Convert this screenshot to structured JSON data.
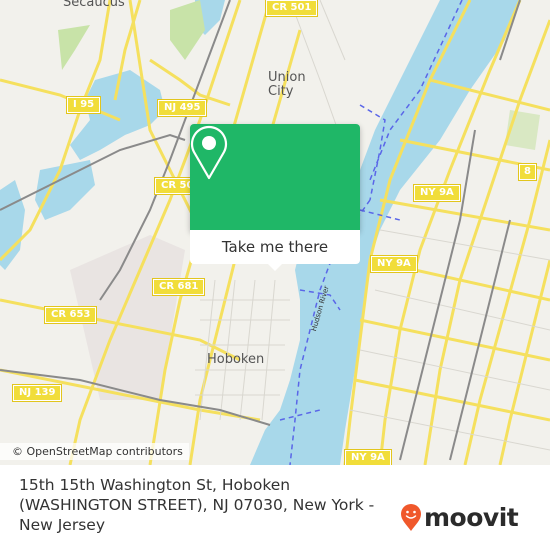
{
  "map": {
    "place_labels": [
      {
        "id": "secaucus",
        "text": "Secaucus"
      },
      {
        "id": "union-city",
        "text": "Union\nCity"
      },
      {
        "id": "hoboken",
        "text": "Hoboken"
      }
    ],
    "road_shields": [
      {
        "id": "cr-501",
        "text": "CR 501"
      },
      {
        "id": "i-95",
        "text": "I 95"
      },
      {
        "id": "nj-495",
        "text": "NJ 495"
      },
      {
        "id": "cr-50x",
        "text": "CR 50"
      },
      {
        "id": "ny-9a-north",
        "text": "NY 9A"
      },
      {
        "id": "ny-9a-mid",
        "text": "NY 9A"
      },
      {
        "id": "ny-9a-south",
        "text": "NY 9A"
      },
      {
        "id": "route-8",
        "text": "8"
      },
      {
        "id": "cr-681",
        "text": "CR 681"
      },
      {
        "id": "cr-653",
        "text": "CR 653"
      },
      {
        "id": "nj-139",
        "text": "NJ 139"
      }
    ],
    "river_label": "Hudson River",
    "attribution": "© OpenStreetMap contributors",
    "colors": {
      "water": "#a8d8ea",
      "land": "#f2f1ec",
      "road": "#f5e05e",
      "park": "#c8e3a8",
      "ferry": "#5a66e8"
    }
  },
  "popup": {
    "icon": "map-pin-icon",
    "button_label": "Take me there",
    "color": "#1fb767"
  },
  "footer": {
    "address": "15th 15th Washington St, Hoboken (WASHINGTON STREET), NJ 07030, New York - New Jersey",
    "logo_text": "moovit",
    "logo_color": "#f0582b"
  }
}
